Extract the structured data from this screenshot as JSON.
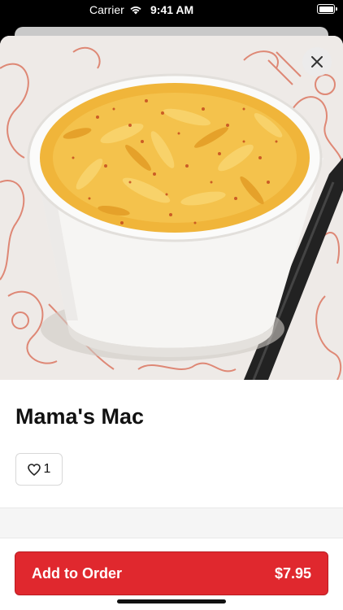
{
  "status_bar": {
    "carrier": "Carrier",
    "time": "9:41 AM"
  },
  "item": {
    "title": "Mama's Mac",
    "image_description_icon": "mac-and-cheese-photo",
    "like_count": "1"
  },
  "order_button": {
    "label": "Add to Order",
    "price": "$7.95"
  },
  "colors": {
    "accent": "#e0282e",
    "cheese": "#f0b53a",
    "paprika": "#c2441c"
  }
}
